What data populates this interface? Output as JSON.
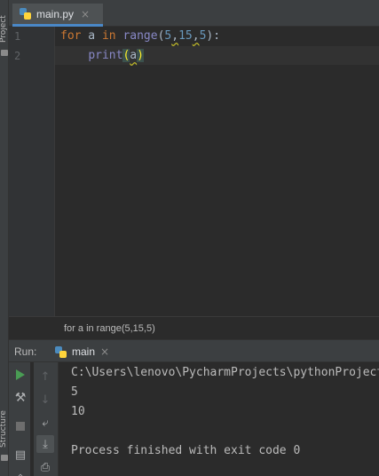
{
  "sidebar": {
    "project_label": "Project",
    "structure_label": "Structure"
  },
  "editor": {
    "tab": {
      "label": "main.py",
      "close": "×"
    },
    "line_numbers": [
      "1",
      "2"
    ],
    "code": {
      "line1": {
        "kw_for": "for",
        "var": " a ",
        "kw_in": "in",
        "sp": " ",
        "fn_range": "range",
        "open": "(",
        "n1": "5",
        "c1": ",",
        "n2": "15",
        "c2": ",",
        "n3": "5",
        "close": "):"
      },
      "line2": {
        "indent": "    ",
        "fn_print": "print",
        "open": "(",
        "arg": "a",
        "close": ")"
      }
    }
  },
  "breadcrumb": {
    "text": "for a in range(5,15,5)"
  },
  "run": {
    "label": "Run:",
    "tab_label": "main",
    "tab_close": "×",
    "console_lines": [
      "C:\\Users\\lenovo\\PycharmProjects\\pythonProject",
      "5",
      "10",
      "",
      "Process finished with exit code 0"
    ]
  },
  "colors": {
    "keyword": "#cc7832",
    "builtin": "#8888c6",
    "number": "#6897bb",
    "text": "#a9b7c6",
    "accent": "#4a88c7"
  }
}
